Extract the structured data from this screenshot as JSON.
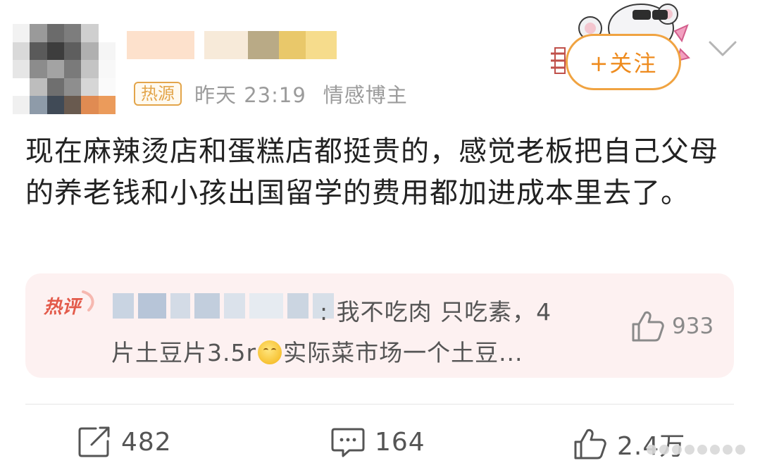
{
  "post": {
    "hot_badge": "热源",
    "time": "昨天 23:19",
    "source": "情感博主",
    "follow_label": "+关注",
    "text": "现在麻辣烫店和蛋糕店都挺贵的，感觉老板把自己父母的养老钱和小孩出国留学的费用都加进成本里去了。"
  },
  "hot_comment": {
    "badge": "热评",
    "text_line1": ": 我不吃肉 只吃素，4",
    "text_line2_a": "片土豆片3.5r",
    "emoji": "smile-emoji",
    "text_line2_b": "实际菜市场一个土豆...",
    "likes": "933"
  },
  "actions": {
    "reposts": "482",
    "comments": "164",
    "likes": "2.4万"
  },
  "colors": {
    "accent_orange": "#ee8b1e",
    "hot_comment_bg": "#fdf1f1",
    "meta_gray": "#9b9b9b",
    "hot_red": "#e35a4a"
  },
  "icons": {
    "repost": "repost-icon",
    "comment": "comment-icon",
    "like": "thumbs-up-icon",
    "more": "chevron-down-icon"
  }
}
